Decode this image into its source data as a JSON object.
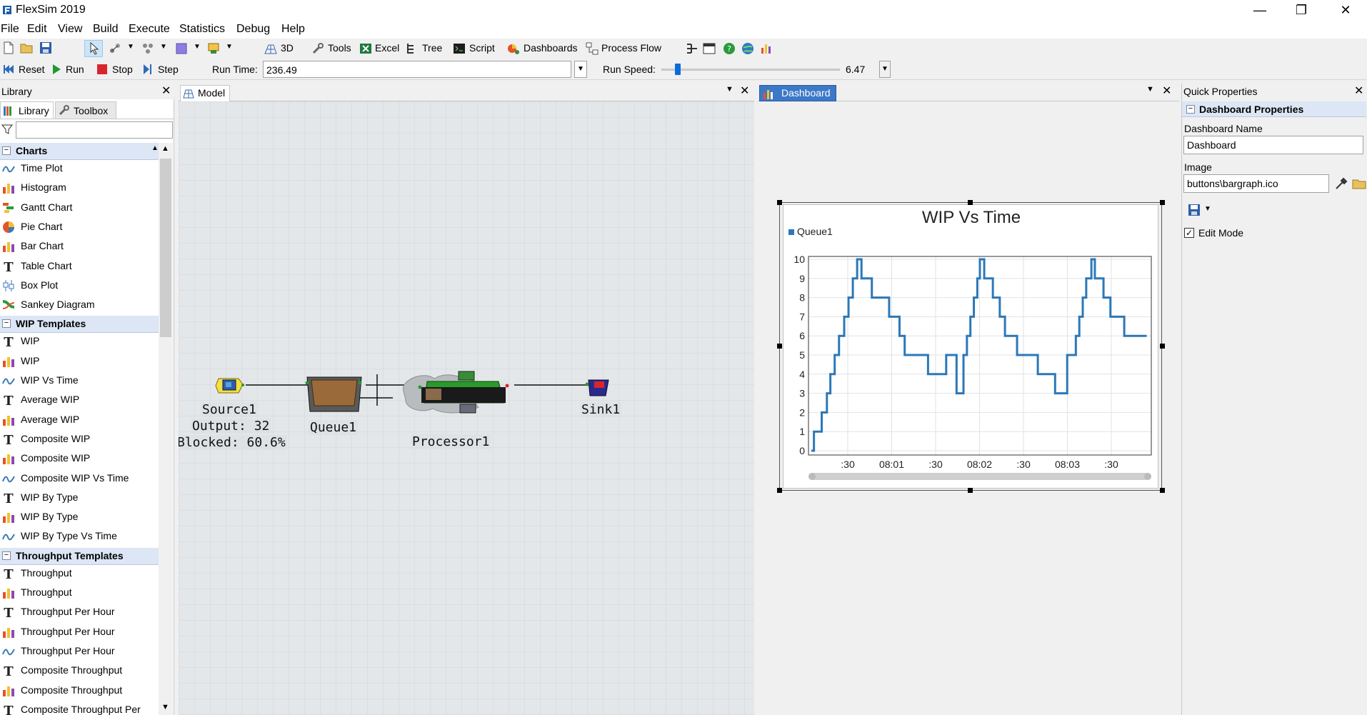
{
  "app": {
    "title": "FlexSim 2019"
  },
  "window_controls": {
    "minimize": "—",
    "restore": "❐",
    "close": "✕"
  },
  "menu": [
    "File",
    "Edit",
    "View",
    "Build",
    "Execute",
    "Statistics",
    "Debug",
    "Help"
  ],
  "toolbar": {
    "view3d": "3D",
    "tools": "Tools",
    "excel": "Excel",
    "tree": "Tree",
    "script": "Script",
    "dashboards": "Dashboards",
    "process_flow": "Process Flow"
  },
  "run_controls": {
    "reset": "Reset",
    "run": "Run",
    "stop": "Stop",
    "step": "Step",
    "run_time_label": "Run Time:",
    "run_time_value": "236.49",
    "run_speed_label": "Run Speed:",
    "run_speed_value": "6.47",
    "run_speed_fraction": 0.08
  },
  "library": {
    "title": "Library",
    "tabs": [
      "Library",
      "Toolbox"
    ],
    "filter_placeholder": "",
    "sections": [
      {
        "name": "Charts",
        "items": [
          {
            "label": "Time Plot",
            "icon": "timeplot"
          },
          {
            "label": "Histogram",
            "icon": "bar"
          },
          {
            "label": "Gantt Chart",
            "icon": "gantt"
          },
          {
            "label": "Pie Chart",
            "icon": "pie"
          },
          {
            "label": "Bar Chart",
            "icon": "bar"
          },
          {
            "label": "Table Chart",
            "icon": "text"
          },
          {
            "label": "Box Plot",
            "icon": "box"
          },
          {
            "label": "Sankey Diagram",
            "icon": "sankey"
          }
        ]
      },
      {
        "name": "WIP Templates",
        "items": [
          {
            "label": "WIP",
            "icon": "text"
          },
          {
            "label": "WIP",
            "icon": "bar"
          },
          {
            "label": "WIP Vs Time",
            "icon": "timeplot"
          },
          {
            "label": "Average WIP",
            "icon": "text"
          },
          {
            "label": "Average WIP",
            "icon": "bar"
          },
          {
            "label": "Composite WIP",
            "icon": "text"
          },
          {
            "label": "Composite WIP",
            "icon": "bar"
          },
          {
            "label": "Composite WIP Vs Time",
            "icon": "timeplot"
          },
          {
            "label": "WIP By Type",
            "icon": "text"
          },
          {
            "label": "WIP By Type",
            "icon": "bar"
          },
          {
            "label": "WIP By Type Vs Time",
            "icon": "timeplot"
          }
        ]
      },
      {
        "name": "Throughput Templates",
        "items": [
          {
            "label": "Throughput",
            "icon": "text"
          },
          {
            "label": "Throughput",
            "icon": "bar"
          },
          {
            "label": "Throughput Per Hour",
            "icon": "text"
          },
          {
            "label": "Throughput Per Hour",
            "icon": "bar"
          },
          {
            "label": "Throughput Per Hour",
            "icon": "timeplot"
          },
          {
            "label": "Composite Throughput",
            "icon": "text"
          },
          {
            "label": "Composite Throughput",
            "icon": "bar"
          },
          {
            "label": "Composite Throughput Per Hou",
            "icon": "text"
          }
        ]
      }
    ]
  },
  "model": {
    "tab": "Model",
    "objects": {
      "source": {
        "name": "Source1",
        "output": "Output: 32",
        "blocked": "Blocked: 60.6%"
      },
      "queue": {
        "name": "Queue1"
      },
      "processor": {
        "name": "Processor1"
      },
      "sink": {
        "name": "Sink1"
      }
    }
  },
  "dashboard": {
    "tab": "Dashboard",
    "colors": {
      "series": "#2b78b8",
      "accent": "#3c78c8"
    }
  },
  "chart_data": {
    "type": "line",
    "title": "WIP Vs Time",
    "legend": [
      "Queue1"
    ],
    "legend_position": "top-left",
    "grid": true,
    "ylim": [
      0,
      10
    ],
    "yticks": [
      "0",
      "1",
      "2",
      "3",
      "4",
      "5",
      "6",
      "7",
      "8",
      "9",
      "10"
    ],
    "xticks": [
      ":30",
      "08:01",
      ":30",
      "08:02",
      ":30",
      "08:03",
      ":30"
    ],
    "series": [
      {
        "name": "Queue1",
        "step": true,
        "x": [
          0,
          3,
          8,
          12,
          18,
          22,
          27,
          32,
          38,
          43,
          48,
          53,
          58,
          62,
          66,
          70,
          78,
          90,
          102,
          108,
          120,
          135,
          148,
          156,
          168,
          176,
          180,
          184,
          188,
          192,
          195,
          200,
          205,
          210,
          218,
          224,
          238,
          250,
          262,
          270,
          282,
          296,
          306,
          310,
          314,
          318,
          324,
          328,
          334,
          338,
          346,
          352,
          362,
          372,
          386,
          388
        ],
        "y": [
          0,
          1,
          1,
          2,
          3,
          4,
          5,
          6,
          7,
          8,
          9,
          10,
          9,
          9,
          9,
          8,
          8,
          7,
          6,
          5,
          5,
          4,
          4,
          5,
          3,
          5,
          6,
          7,
          8,
          9,
          10,
          9,
          9,
          8,
          7,
          6,
          5,
          5,
          4,
          4,
          3,
          5,
          6,
          7,
          8,
          9,
          10,
          9,
          9,
          8,
          7,
          7,
          6,
          6,
          6,
          6
        ]
      }
    ]
  },
  "quick_properties": {
    "title": "Quick Properties",
    "section": "Dashboard Properties",
    "name_label": "Dashboard Name",
    "name_value": "Dashboard",
    "image_label": "Image",
    "image_value": "buttons\\bargraph.ico",
    "edit_mode_label": "Edit Mode",
    "edit_mode_checked": true
  }
}
